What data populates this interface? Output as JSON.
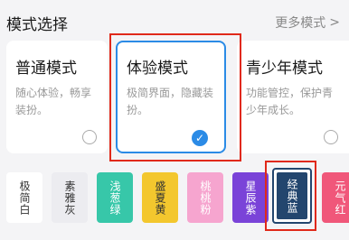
{
  "header": {
    "title": "模式选择",
    "more_label": "更多模式",
    "more_icon": "chevron-right-icon"
  },
  "modes": [
    {
      "title": "普通模式",
      "desc": "随心体验，畅享装扮。",
      "selected": false
    },
    {
      "title": "体验模式",
      "desc": "极简界面，隐藏装扮。",
      "selected": true
    },
    {
      "title": "青少年模式",
      "desc": "功能管控，保护青少年成长。",
      "selected": false
    }
  ],
  "themes": [
    {
      "label": "极简白",
      "bg": "#ffffff",
      "fg": "#333333",
      "selected": false
    },
    {
      "label": "素雅灰",
      "bg": "#ececf0",
      "fg": "#333333",
      "selected": false
    },
    {
      "label": "浅葱绿",
      "bg": "#37c7a9",
      "fg": "#ffffff",
      "selected": false
    },
    {
      "label": "盛夏黄",
      "bg": "#f3c72e",
      "fg": "#333333",
      "selected": false
    },
    {
      "label": "桃桃粉",
      "bg": "#f6a5cf",
      "fg": "#ffffff",
      "selected": false
    },
    {
      "label": "星辰紫",
      "bg": "#7a43d8",
      "fg": "#ffffff",
      "selected": false
    },
    {
      "label": "经典蓝",
      "bg": "#23466e",
      "fg": "#ffffff",
      "selected": true
    },
    {
      "label": "元气红",
      "bg": "#f0577a",
      "fg": "#ffffff",
      "selected": false
    }
  ],
  "colors": {
    "accent": "#2b8be6",
    "highlight_box": "#e0291a"
  }
}
